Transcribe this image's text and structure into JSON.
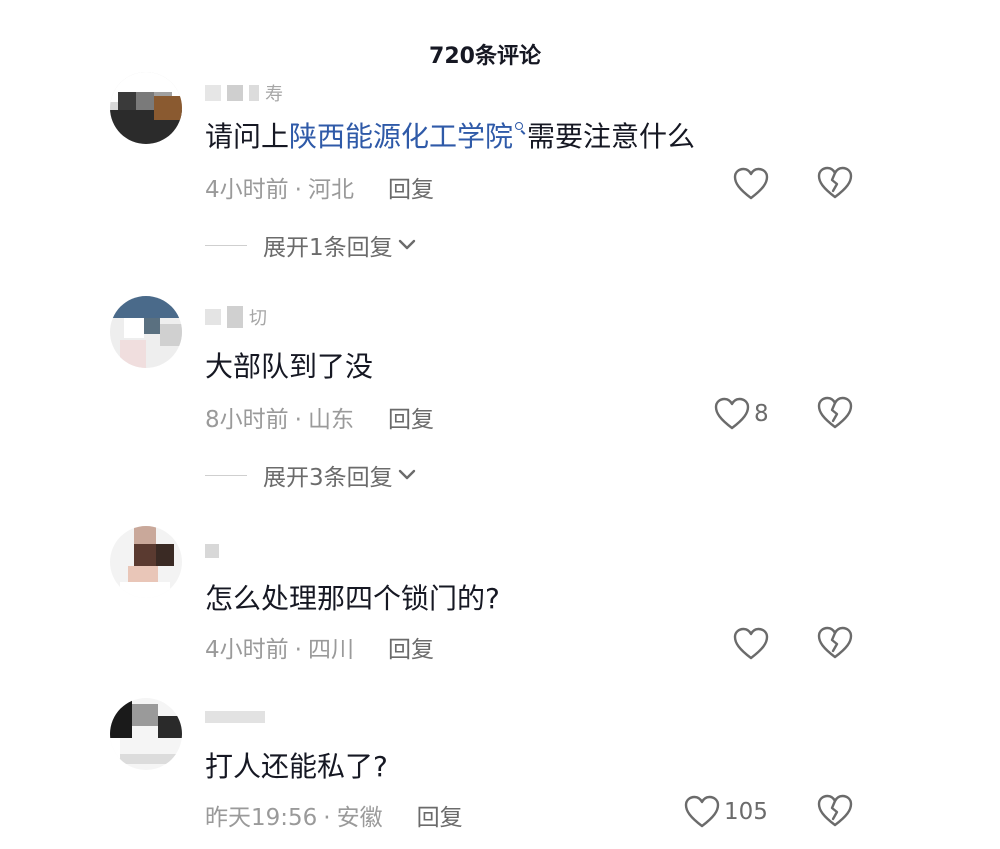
{
  "header": {
    "title": "720条评论"
  },
  "comments": [
    {
      "username_char": "寿",
      "text_before": "请问上",
      "link": "陕西能源化工学院",
      "text_after": "需要注意什么",
      "time": "4小时前",
      "dot": "·",
      "location": "河北",
      "reply_label": "回复",
      "like_count": "",
      "expand_label": "展开1条回复"
    },
    {
      "username_char": "切",
      "text": "大部队到了没",
      "time": "8小时前",
      "dot": "·",
      "location": "山东",
      "reply_label": "回复",
      "like_count": "8",
      "expand_label": "展开3条回复"
    },
    {
      "username_char": "",
      "text": "怎么处理那四个锁门的?",
      "time": "4小时前",
      "dot": "·",
      "location": "四川",
      "reply_label": "回复",
      "like_count": ""
    },
    {
      "username_char": "",
      "text": "打人还能私了?",
      "time": "昨天19:56",
      "dot": "·",
      "location": "安徽",
      "reply_label": "回复",
      "like_count": "105"
    }
  ],
  "icons": {
    "like": "heart-outline-icon",
    "dislike": "broken-heart-icon",
    "expand": "chevron-down-icon",
    "search": "search-icon"
  },
  "colors": {
    "link": "#2f5aa8",
    "text": "#161823",
    "meta": "#9a9a9a"
  }
}
